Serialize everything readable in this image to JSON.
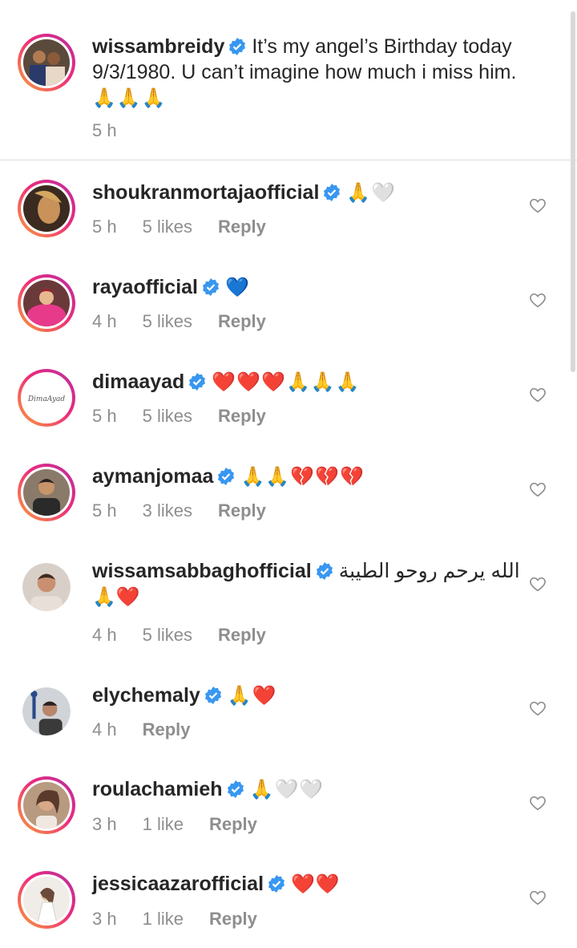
{
  "caption": {
    "username": "wissambreidy",
    "text": "It’s my angel’s Birthday today 9/3/1980. U can’t imagine how much i miss him. ",
    "emoji": "🙏🙏🙏",
    "time": "5 h"
  },
  "comments": [
    {
      "username": "shoukranmortajaofficial",
      "text": "",
      "emoji": "🙏🤍",
      "time": "5 h",
      "likes": "5 likes",
      "reply": "Reply"
    },
    {
      "username": "rayaofficial",
      "text": "",
      "emoji": "💙",
      "time": "4 h",
      "likes": "5 likes",
      "reply": "Reply"
    },
    {
      "username": "dimaayad",
      "text": "",
      "emoji": "❤️❤️❤️🙏🙏🙏",
      "time": "5 h",
      "likes": "5 likes",
      "reply": "Reply",
      "avatar_text": "DimaAyad"
    },
    {
      "username": "aymanjomaa",
      "text": "",
      "emoji": "🙏🙏💔💔💔",
      "time": "5 h",
      "likes": "3 likes",
      "reply": "Reply"
    },
    {
      "username": "wissamsabbaghofficial",
      "text": "الله يرحم روحو الطيبة",
      "emoji": "🙏❤️",
      "time": "4 h",
      "likes": "5 likes",
      "reply": "Reply"
    },
    {
      "username": "elychemaly",
      "text": "",
      "emoji": "🙏❤️",
      "time": "4 h",
      "likes": "",
      "reply": "Reply"
    },
    {
      "username": "roulachamieh",
      "text": "",
      "emoji": "🙏🤍🤍",
      "time": "3 h",
      "likes": "1 like",
      "reply": "Reply"
    },
    {
      "username": "jessicaazarofficial",
      "text": "",
      "emoji": "❤️❤️",
      "time": "3 h",
      "likes": "1 like",
      "reply": "Reply"
    }
  ],
  "colors": {
    "verified": "#3897f0",
    "meta": "#8e8e8e",
    "ring_start": "#f9a13a",
    "ring_end": "#b62fa3"
  }
}
